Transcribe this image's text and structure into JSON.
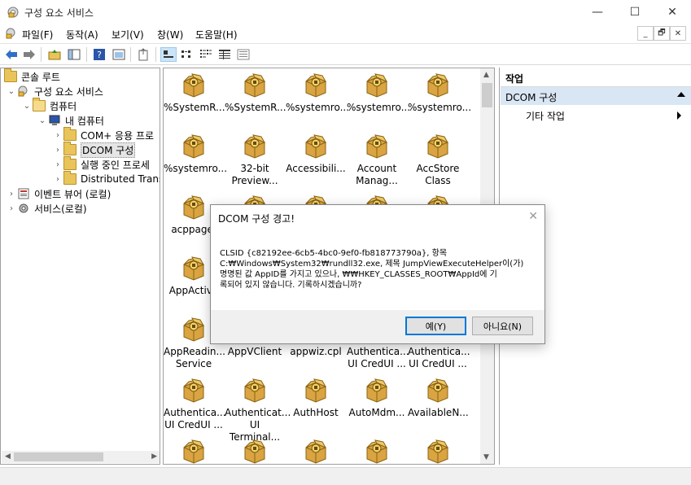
{
  "window": {
    "title": "구성 요소 서비스",
    "min_glyph": "—",
    "max_glyph": "☐",
    "close_glyph": "✕"
  },
  "menubar": {
    "items": [
      "파일(F)",
      "동작(A)",
      "보기(V)",
      "창(W)",
      "도움말(H)"
    ],
    "mdi_min": "_",
    "mdi_restore": "🗗",
    "mdi_close": "✕"
  },
  "toolbar": {
    "icons": [
      "back-icon",
      "forward-icon",
      "up-folder-icon",
      "show-hide-tree-icon",
      "help-icon",
      "properties-icon",
      "export-icon",
      "large-icons-view-icon",
      "small-icons-view-icon",
      "list-view-icon",
      "detail-view-icon",
      "details-alt-icon"
    ]
  },
  "tree": {
    "items": [
      {
        "label": "콘솔 루트",
        "level": 0,
        "expander": ""
      },
      {
        "label": "구성 요소 서비스",
        "level": 1,
        "expander": "⌄"
      },
      {
        "label": "컴퓨터",
        "level": 2,
        "expander": "⌄"
      },
      {
        "label": "내 컴퓨터",
        "level": 3,
        "expander": "⌄"
      },
      {
        "label": "COM+ 응용 프로",
        "level": 4,
        "expander": "›"
      },
      {
        "label": "DCOM 구성",
        "level": 4,
        "expander": "›",
        "selected": true
      },
      {
        "label": "실행 중인 프로세",
        "level": 4,
        "expander": "›"
      },
      {
        "label": "Distributed Trans",
        "level": 4,
        "expander": "›"
      },
      {
        "label": "이벤트 뷰어 (로컬)",
        "level": 1,
        "expander": "›"
      },
      {
        "label": "서비스(로컬)",
        "level": 1,
        "expander": "›"
      }
    ]
  },
  "list": {
    "items": [
      [
        "%SystemR...",
        "%SystemR...",
        "%systemro...",
        "%systemro...",
        "%systemro..."
      ],
      [
        "%systemro...",
        "32-bit\nPreview...",
        "Accessibili...",
        "Account\nManag...",
        "AccStore\nClass"
      ],
      [
        "acppage.",
        "",
        "",
        "",
        ""
      ],
      [
        "AppActiva",
        "",
        "",
        "",
        ""
      ],
      [
        "AppReadin...\nService",
        "AppVClient",
        "appwiz.cpl",
        "Authentica...\nUI CredUI ...",
        "Authentica...\nUI CredUI ..."
      ],
      [
        "Authentica...\nUI CredUI ...",
        "Authenticat...\nUI Terminal...",
        "AuthHost",
        "AutoMdm...",
        "AvailableN..."
      ],
      [
        "",
        "",
        "",
        "",
        ""
      ]
    ]
  },
  "actions": {
    "header": "작업",
    "section": "DCOM 구성",
    "item": "기타 작업"
  },
  "dialog": {
    "title": "DCOM 구성 경고!",
    "line1": "CLSID {c82192ee-6cb5-4bc0-9ef0-fb818773790a}, 항목",
    "line2": "C:₩Windows₩System32₩rundll32.exe, 제목 JumpViewExecuteHelper이(가)",
    "line3": "명명된 값 AppID를 가지고 있으나, ₩₩HKEY_CLASSES_ROOT₩AppId에 기",
    "line4": "록되어 있지 않습니다. 기록하시겠습니까?",
    "yes_label": "예(Y)",
    "no_label": "아니요(N)",
    "close_glyph": "✕"
  },
  "colors": {
    "selection": "#cce4f7",
    "action_section": "#d9e6f3",
    "default_button_border": "#0078d7"
  }
}
